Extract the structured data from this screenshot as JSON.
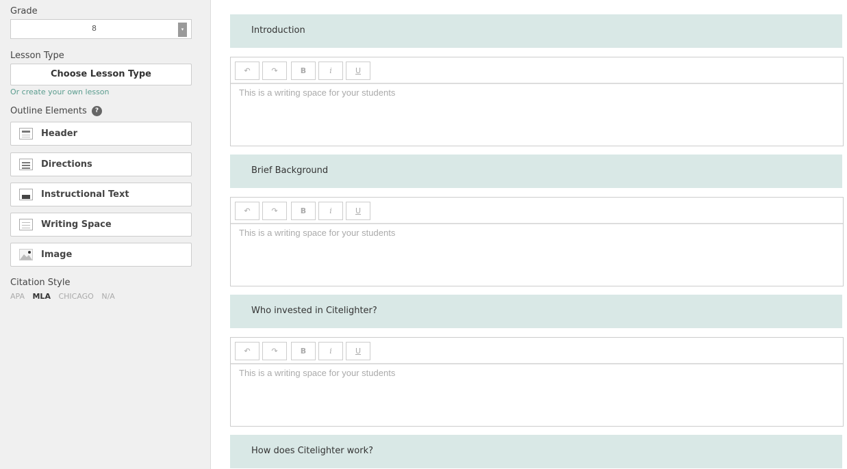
{
  "sidebar": {
    "grade_label": "Grade",
    "grade_value": "8",
    "arrow_glyph": "▾",
    "lesson_type_label": "Lesson Type",
    "choose_lesson_label": "Choose Lesson Type",
    "create_own_link": "Or create your own lesson",
    "outline_label": "Outline Elements",
    "help_glyph": "?",
    "elements": [
      {
        "label": "Header",
        "icon": "header-icon"
      },
      {
        "label": "Directions",
        "icon": "directions-icon"
      },
      {
        "label": "Instructional Text",
        "icon": "instructional-text-icon"
      },
      {
        "label": "Writing Space",
        "icon": "writing-space-icon"
      },
      {
        "label": "Image",
        "icon": "image-icon"
      }
    ],
    "citation_label": "Citation Style",
    "citation_options": [
      "APA",
      "MLA",
      "CHICAGO",
      "N/A"
    ],
    "citation_selected": "MLA"
  },
  "toolbar": {
    "undo": "↶",
    "redo": "↷",
    "bold": "B",
    "italic": "i",
    "underline": "U"
  },
  "sections": [
    {
      "title": "Introduction",
      "placeholder": "This is a writing space for your students"
    },
    {
      "title": "Brief Background",
      "placeholder": "This is a writing space for your students"
    },
    {
      "title": "Who invested in Citelighter?",
      "placeholder": "This is a writing space for your students"
    },
    {
      "title": "How does Citelighter work?"
    }
  ],
  "colors": {
    "section_header_bg": "#d9e8e6",
    "link": "#5a9c8e",
    "sidebar_bg": "#f0f0f0"
  }
}
